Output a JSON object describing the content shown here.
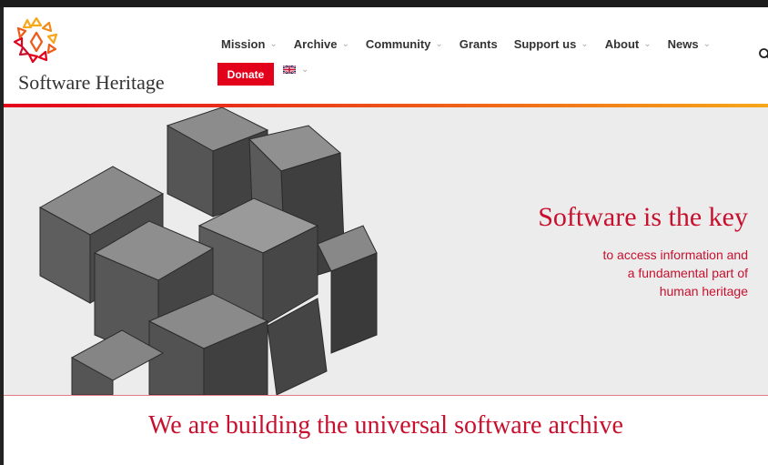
{
  "brand": {
    "name": "Software Heritage",
    "colors": {
      "accent": "#e3001b",
      "title_red": "#c8102e",
      "gradient_start": "#e3001b",
      "gradient_end": "#f6a71a"
    }
  },
  "nav": {
    "items": [
      {
        "label": "Mission",
        "has_dropdown": true
      },
      {
        "label": "Archive",
        "has_dropdown": true
      },
      {
        "label": "Community",
        "has_dropdown": true
      },
      {
        "label": "Grants",
        "has_dropdown": false
      },
      {
        "label": "Support us",
        "has_dropdown": true
      },
      {
        "label": "About",
        "has_dropdown": true
      },
      {
        "label": "News",
        "has_dropdown": true
      }
    ],
    "donate_label": "Donate",
    "language_icon": "uk-flag-icon",
    "search_icon": "search-icon"
  },
  "hero": {
    "headline": "Software is the key",
    "subtitle_lines": [
      "to access information and",
      "a fundamental part of",
      "human heritage"
    ],
    "image": "wooden-puzzle-image"
  },
  "section": {
    "title": "We are building the universal software archive"
  }
}
